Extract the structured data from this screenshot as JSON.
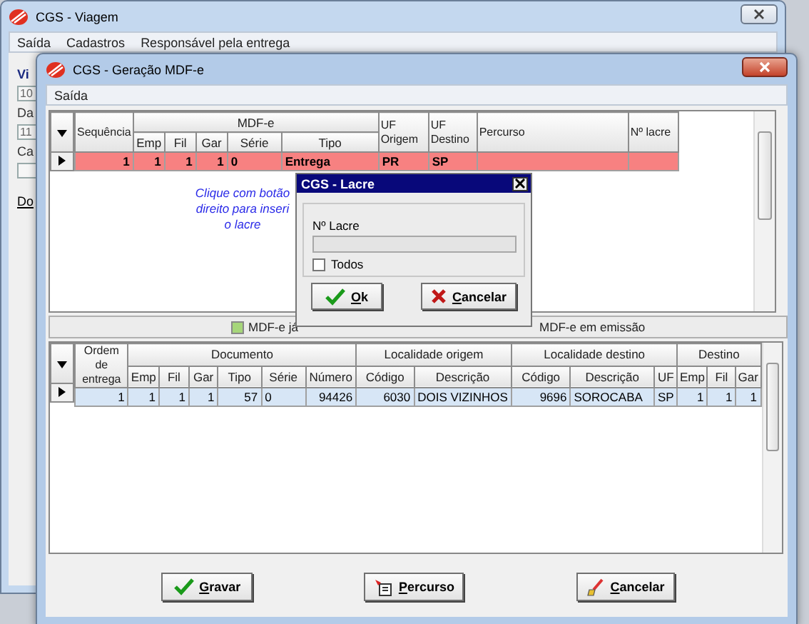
{
  "background_window": {
    "title": "CGS - Viagem",
    "menu": [
      "Saída",
      "Cadastros",
      "Responsável pela entrega"
    ],
    "items": [
      {
        "kind": "label",
        "text": "Vi"
      },
      {
        "kind": "field",
        "text": "10"
      },
      {
        "kind": "label",
        "text": "Da"
      },
      {
        "kind": "field",
        "text": "11"
      },
      {
        "kind": "label",
        "text": "Ca"
      },
      {
        "kind": "field"
      },
      {
        "kind": "link",
        "text": "Do"
      }
    ]
  },
  "main_window": {
    "title": "CGS - Geração MDF-e",
    "menu": [
      "Saída"
    ],
    "top_grid": {
      "header_rows": [
        [
          {
            "text": "Sequência",
            "rowspan": 2,
            "numeric": true
          },
          {
            "text": "MDF-e",
            "colspan": 5
          },
          {
            "text": "UF Origem",
            "rowspan": 2
          },
          {
            "text": "UF Destino",
            "rowspan": 2
          },
          {
            "text": "Percurso",
            "rowspan": 2
          },
          {
            "text": "Nº lacre",
            "rowspan": 2
          }
        ],
        [
          {
            "text": "Emp",
            "numeric": true
          },
          {
            "text": "Fil",
            "numeric": true
          },
          {
            "text": "Gar",
            "numeric": true
          },
          {
            "text": "Série"
          },
          {
            "text": "Tipo"
          }
        ]
      ],
      "rows": [
        {
          "cells": [
            "1",
            "1",
            "1",
            "1",
            "0",
            "Entrega",
            "PR",
            "SP"
          ],
          "color": "#f78181",
          "selected": true
        }
      ]
    },
    "hint_lines": [
      "Clique com botão",
      "direito para inseri",
      "o lacre"
    ],
    "legend": [
      {
        "label": "MDF-e já",
        "color": "#a6d67a"
      },
      {
        "label": "MDF-e em emissão"
      }
    ],
    "bottom_grid": {
      "header_rows": [
        [
          {
            "text": "Ordem de entrega",
            "rowspan": 2,
            "numeric": true
          },
          {
            "text": "Documento",
            "colspan": 6
          },
          {
            "text": "Localidade origem",
            "colspan": 2
          },
          {
            "text": "Localidade destino",
            "colspan": 3
          },
          {
            "text": "Destino",
            "colspan": 3
          }
        ],
        [
          {
            "text": "Emp",
            "numeric": true
          },
          {
            "text": "Fil",
            "numeric": true
          },
          {
            "text": "Gar",
            "numeric": true
          },
          {
            "text": "Tipo",
            "numeric": true
          },
          {
            "text": "Série"
          },
          {
            "text": "Número",
            "numeric": true
          },
          {
            "text": "Código",
            "numeric": true
          },
          {
            "text": "Descrição"
          },
          {
            "text": "Código",
            "numeric": true
          },
          {
            "text": "Descrição"
          },
          {
            "text": "UF"
          },
          {
            "text": "Emp",
            "numeric": true
          },
          {
            "text": "Fil",
            "numeric": true
          },
          {
            "text": "Gar",
            "numeric": true
          }
        ]
      ],
      "rows": [
        {
          "cells": [
            "1",
            "1",
            "1",
            "1",
            "57",
            "0",
            "94426",
            "6030",
            "DOIS VIZINHOS",
            "9696",
            "SOROCABA",
            "SP",
            "1",
            "1",
            "1"
          ],
          "selected": true
        }
      ]
    },
    "buttons": [
      {
        "label": "Gravar",
        "kind": "save"
      },
      {
        "label": "Percurso",
        "kind": "route"
      },
      {
        "label": "Cancelar",
        "kind": "cancel"
      }
    ]
  },
  "dialog": {
    "title": "CGS - Lacre",
    "field": {
      "label": "Nº Lacre",
      "disabled": true
    },
    "checkbox": {
      "label": "Todos",
      "checked": false
    },
    "buttons": [
      {
        "label": "Ok",
        "kind": "confirm"
      },
      {
        "label": "Cancelar",
        "kind": "close"
      }
    ]
  }
}
